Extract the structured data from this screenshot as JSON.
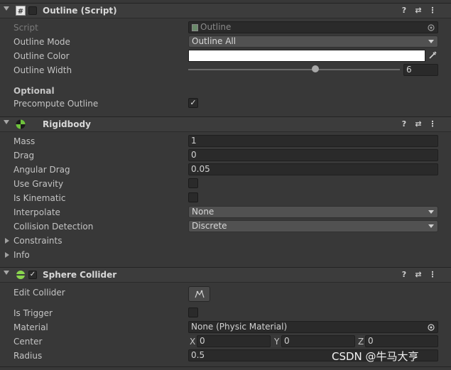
{
  "outline": {
    "title": "Outline (Script)",
    "script_label": "Script",
    "script_value": "Outline",
    "mode_label": "Outline Mode",
    "mode_value": "Outline All",
    "color_label": "Outline Color",
    "color_value": "#ffffff",
    "width_label": "Outline Width",
    "width_value": "6",
    "width_fraction": 0.6,
    "optional_heading": "Optional",
    "precompute_label": "Precompute Outline",
    "precompute_checked": true
  },
  "rigidbody": {
    "title": "Rigidbody",
    "mass_label": "Mass",
    "mass_value": "1",
    "drag_label": "Drag",
    "drag_value": "0",
    "angular_drag_label": "Angular Drag",
    "angular_drag_value": "0.05",
    "use_gravity_label": "Use Gravity",
    "is_kinematic_label": "Is Kinematic",
    "interpolate_label": "Interpolate",
    "interpolate_value": "None",
    "collision_label": "Collision Detection",
    "collision_value": "Discrete",
    "constraints_label": "Constraints",
    "info_label": "Info"
  },
  "sphere": {
    "title": "Sphere Collider",
    "edit_collider_label": "Edit Collider",
    "is_trigger_label": "Is Trigger",
    "material_label": "Material",
    "material_value": "None (Physic Material)",
    "center_label": "Center",
    "center": {
      "x_label": "X",
      "x": "0",
      "y_label": "Y",
      "y": "0",
      "z_label": "Z",
      "z": "0"
    },
    "radius_label": "Radius",
    "radius_value": "0.5"
  },
  "header_buttons": {
    "help": "?",
    "preset": "⇄",
    "menu": "⋮"
  },
  "watermark": "CSDN @牛马大亨"
}
